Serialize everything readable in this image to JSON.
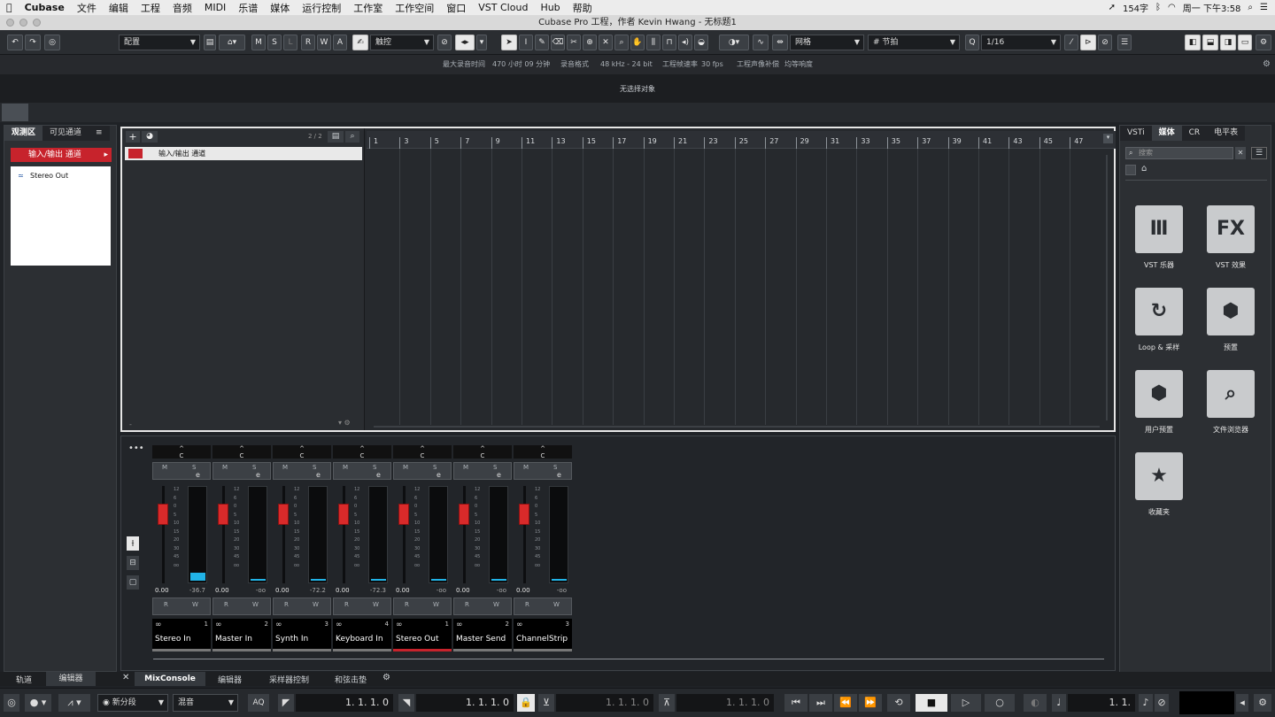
{
  "menubar": {
    "apple": "",
    "app": "Cubase",
    "items": [
      "文件",
      "编辑",
      "工程",
      "音频",
      "MIDI",
      "乐谱",
      "媒体",
      "运行控制",
      "工作室",
      "工作空间",
      "窗口",
      "VST Cloud",
      "Hub",
      "帮助"
    ],
    "status_count": "154字",
    "clock": "周一 下午3:58"
  },
  "window": {
    "title": "Cubase Pro 工程，作者 Kevin Hwang - 无标题1"
  },
  "toolbar": {
    "config_label": "配置",
    "automation_mode": "触控",
    "snap_type": "网格",
    "grid_type": "节拍",
    "quantize": "1/16",
    "ms_buttons": [
      "M",
      "S",
      "L",
      "R",
      "W",
      "A"
    ]
  },
  "statusline": {
    "max_record_label": "最大录音时间",
    "max_record_value": "470 小时 09 分钟",
    "record_format_label": "录音格式",
    "record_format_value": "48 kHz - 24 bit",
    "frame_rate_label": "工程帧速率",
    "frame_rate_value": "30 fps",
    "pan_law_label": "工程声像补偿",
    "pan_law_value": "均等响度"
  },
  "infoline": {
    "text": "无选择对象"
  },
  "inspector": {
    "tabs": [
      "观测区",
      "可见通道"
    ],
    "io_button": "输入/输出 通道",
    "list_item": "Stereo Out"
  },
  "project": {
    "track_count": "2 / 2",
    "track_name": "输入/输出 通道",
    "ruler": [
      "1",
      "3",
      "5",
      "7",
      "9",
      "11",
      "13",
      "15",
      "17",
      "19",
      "21",
      "23",
      "25",
      "27",
      "29",
      "31",
      "33",
      "35",
      "37",
      "39",
      "41",
      "43",
      "45",
      "47"
    ]
  },
  "mixer": {
    "channels": [
      {
        "pan": "C",
        "vol": "0.00",
        "peak": "-36.7",
        "name": "Stereo In",
        "num": "1",
        "active": false,
        "meter": 0.08
      },
      {
        "pan": "C",
        "vol": "0.00",
        "peak": "-oo",
        "name": "Master In",
        "num": "2",
        "active": false,
        "meter": 0
      },
      {
        "pan": "C",
        "vol": "0.00",
        "peak": "-72.2",
        "name": "Synth In",
        "num": "3",
        "active": false,
        "meter": 0.02
      },
      {
        "pan": "C",
        "vol": "0.00",
        "peak": "-72.3",
        "name": "Keyboard In",
        "num": "4",
        "active": false,
        "meter": 0.02
      },
      {
        "pan": "C",
        "vol": "0.00",
        "peak": "-oo",
        "name": "Stereo Out",
        "num": "1",
        "active": true,
        "meter": 0
      },
      {
        "pan": "C",
        "vol": "0.00",
        "peak": "-oo",
        "name": "Master Send",
        "num": "2",
        "active": false,
        "meter": 0
      },
      {
        "pan": "C",
        "vol": "0.00",
        "peak": "-oo",
        "name": "ChannelStrip",
        "num": "3",
        "active": false,
        "meter": 0
      }
    ],
    "scale": [
      "12",
      "6",
      "0",
      "5",
      "10",
      "15",
      "20",
      "30",
      "45",
      "oo"
    ]
  },
  "mediapane": {
    "tabs": [
      "VSTi",
      "媒体",
      "CR",
      "电平表"
    ],
    "search_placeholder": "搜索",
    "tiles": [
      {
        "label": "VST 乐器",
        "glyph": "Ⅲ"
      },
      {
        "label": "VST 效果",
        "glyph": "FX"
      },
      {
        "label": "Loop & 采样",
        "glyph": "↻"
      },
      {
        "label": "预置",
        "glyph": "⬢"
      },
      {
        "label": "用户预置",
        "glyph": "⬢"
      },
      {
        "label": "文件浏览器",
        "glyph": "⌕"
      },
      {
        "label": "收藏夹",
        "glyph": "★"
      }
    ]
  },
  "bottomtabs": {
    "left": [
      "轨道",
      "编辑器"
    ],
    "right": [
      "MixConsole",
      "编辑器",
      "采样器控制",
      "和弦击垫"
    ]
  },
  "transport": {
    "record_mode": "新分段",
    "mix_mode": "混音",
    "aq": "AQ",
    "left_locator": "1. 1. 1.   0",
    "right_locator": "1. 1. 1.   0",
    "punch_in": "1. 1. 1.   0",
    "punch_out": "1. 1. 1.   0",
    "position": "1. 1."
  },
  "colors": {
    "accent_red": "#c7232c",
    "meter_blue": "#21b3e6"
  }
}
